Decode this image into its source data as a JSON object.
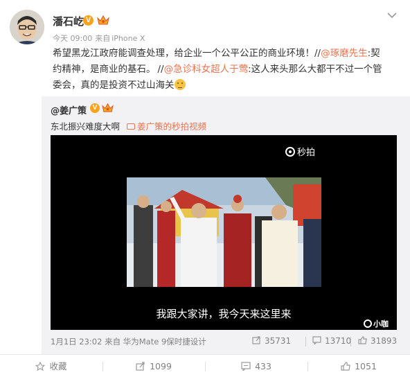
{
  "post": {
    "author": "潘石屹",
    "verified_badge": "V",
    "time": "今天 09:00",
    "source_prefix": "来自",
    "source": "iPhone X",
    "text_line1_a": "希望黑龙江政府能调查处理，给企业一个公平公正的商业环境！",
    "text_slashes1": "//",
    "mention1": "@琢磨先生",
    "text_line1_b": ":契",
    "text_line2_a": "约精神，是商业的基石。",
    "text_slashes2": "//",
    "mention2": "@急诊科女超人于莺",
    "text_line2_b": ":这人来头那么大都干不过一个管",
    "text_line3": "委会，真的是投资不过山海关"
  },
  "repost": {
    "author": "@姜广策",
    "verified_badge": "V",
    "text": "东北振兴难度大啊",
    "video_link": "姜广策的秒拍视频",
    "video": {
      "logo": "秒拍",
      "subtitle": "我跟大家讲，我今天来这里来",
      "watermark": "小咖"
    },
    "footer_date": "1月1日 23:02",
    "footer_source": "来自 华为Mate 9保时捷设计",
    "reposts": "35731",
    "comments": "13710",
    "likes": "31893"
  },
  "actions": {
    "favorite": "收藏",
    "repost": "1099",
    "comment": "433",
    "like": "1051"
  },
  "colors": {
    "link": "#eb7350",
    "meta": "#999999",
    "repost_bg": "#f2f2f5",
    "badge": "#f7a31c"
  },
  "icons": [
    "chevron-down-icon",
    "crown-icon",
    "video-camera-icon",
    "miaopai-logo-icon",
    "share-icon",
    "comment-icon",
    "like-icon",
    "favorite-icon",
    "emoji-icon"
  ]
}
